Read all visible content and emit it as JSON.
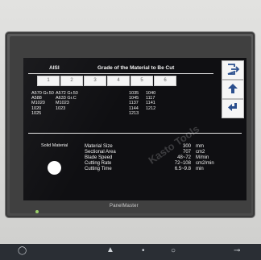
{
  "header": {
    "standard_label": "AISI",
    "title": "Grade of the Material to Be Cut"
  },
  "grade_buttons": [
    "1",
    "2",
    "3",
    "4",
    "5",
    "6"
  ],
  "grades": {
    "col1": [
      "A570 Gr.50",
      "A588",
      "M1020",
      "1020",
      "1025"
    ],
    "col2": [
      "A572 Gr.50",
      "A633 Gr.C",
      "M1023",
      "1023"
    ],
    "col3": [
      "1035",
      "1045",
      "1137",
      "1144",
      "1213"
    ],
    "col4": [
      "1040",
      "1117",
      "1141",
      "1212"
    ]
  },
  "material": {
    "label": "Solid Material",
    "rows": [
      {
        "name": "Material Size",
        "value": "300",
        "unit": "mm"
      },
      {
        "name": "Sectional Area",
        "value": "707",
        "unit": "cm2"
      },
      {
        "name": "Blade Speed",
        "value": "48~72",
        "unit": "M/min"
      },
      {
        "name": "Cutting Rate",
        "value": "72~108",
        "unit": "cm2/min"
      },
      {
        "name": "Cutting Time",
        "value": "6.5~9.8",
        "unit": "min"
      }
    ]
  },
  "side_buttons": {
    "top_icon": "exit-icon",
    "middle_icon": "arrow-up-icon",
    "bottom_icon": "arrow-back-icon"
  },
  "device": {
    "brand": "PanelMaster"
  },
  "watermark": "Kasto Tools",
  "colors": {
    "screen_bg": "#0f0f12",
    "text": "#f2f2f2",
    "button_bg": "#f4f4f4"
  }
}
